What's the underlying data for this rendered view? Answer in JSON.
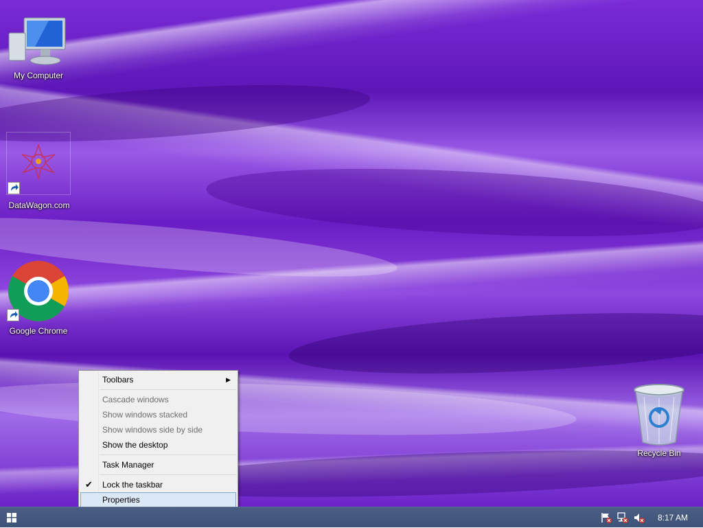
{
  "desktop": {
    "icons": [
      {
        "name": "my-computer",
        "label": "My Computer"
      },
      {
        "name": "datawagon",
        "label": "DataWagon.com"
      },
      {
        "name": "google-chrome",
        "label": "Google Chrome"
      },
      {
        "name": "recycle-bin",
        "label": "Recycle Bin"
      }
    ]
  },
  "context_menu": {
    "items": [
      {
        "label": "Toolbars"
      },
      {
        "label": "Cascade windows"
      },
      {
        "label": "Show windows stacked"
      },
      {
        "label": "Show windows side by side"
      },
      {
        "label": "Show the desktop"
      },
      {
        "label": "Task Manager"
      },
      {
        "label": "Lock the taskbar",
        "checked": true
      },
      {
        "label": "Properties"
      }
    ],
    "submenu_glyph": "▶",
    "check_glyph": "✔"
  },
  "taskbar": {
    "clock": "8:17 AM",
    "tray_icons": [
      "action-center-flag-icon",
      "network-icon",
      "volume-muted-icon"
    ]
  },
  "colors": {
    "taskbar": "#3d5277",
    "menu_bg": "#f0f0f0",
    "menu_highlight": "#dbe9f7",
    "wallpaper_purple": "#6a1cc4"
  }
}
